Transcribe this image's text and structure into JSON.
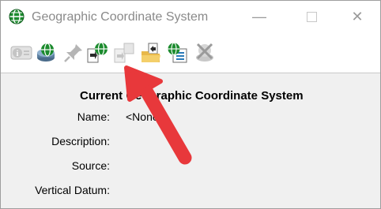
{
  "window": {
    "title": "Geographic Coordinate System",
    "controls": {
      "minimize": "—",
      "close": "✕"
    }
  },
  "toolbar": {
    "buttons": [
      {
        "icon": "info-icon",
        "enabled": false
      },
      {
        "icon": "database-globe-icon",
        "enabled": true
      },
      {
        "icon": "pin-icon",
        "enabled": false
      },
      {
        "icon": "import-globe-icon",
        "enabled": true
      },
      {
        "icon": "export-icon",
        "enabled": false
      },
      {
        "icon": "open-folder-icon",
        "enabled": true
      },
      {
        "icon": "globe-list-icon",
        "enabled": true
      },
      {
        "icon": "delete-icon",
        "enabled": false
      }
    ]
  },
  "panel": {
    "heading": "Current Geographic Coordinate System",
    "fields": [
      {
        "label": "Name:",
        "value": "<None>"
      },
      {
        "label": "Description:",
        "value": ""
      },
      {
        "label": "Source:",
        "value": ""
      },
      {
        "label": "Vertical Datum:",
        "value": ""
      }
    ]
  },
  "colors": {
    "annotation_arrow": "#e8383b",
    "panel_bg": "#f0f0f0",
    "globe": "#1c8b2e"
  }
}
